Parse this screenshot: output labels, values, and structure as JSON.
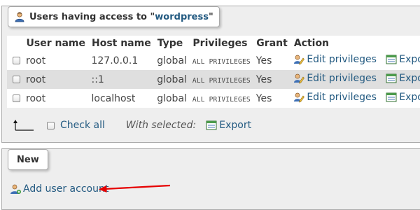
{
  "users_section": {
    "legend_prefix": "Users having access to \"",
    "legend_db": "wordpress",
    "legend_suffix": "\"",
    "legend_icon": "users-icon",
    "columns": [
      "",
      "User name",
      "Host name",
      "Type",
      "Privileges",
      "Grant",
      "Action"
    ],
    "rows": [
      {
        "user": "root",
        "host": "127.0.0.1",
        "type": "global",
        "privileges": "ALL PRIVILEGES",
        "grant": "Yes",
        "edit": "Edit privileges",
        "export": "Export"
      },
      {
        "user": "root",
        "host": "::1",
        "type": "global",
        "privileges": "ALL PRIVILEGES",
        "grant": "Yes",
        "edit": "Edit privileges",
        "export": "Export"
      },
      {
        "user": "root",
        "host": "localhost",
        "type": "global",
        "privileges": "ALL PRIVILEGES",
        "grant": "Yes",
        "edit": "Edit privileges",
        "export": "Export"
      }
    ],
    "check_all": "Check all",
    "with_selected": "With selected:",
    "export_selected": "Export"
  },
  "new_section": {
    "legend": "New",
    "add_user": "Add user account",
    "add_user_icon": "add-user-icon"
  },
  "colors": {
    "link": "#235a81",
    "row_alt": "#dfdfdf",
    "panel": "#eeeeee",
    "annotation_arrow": "#e60000"
  }
}
